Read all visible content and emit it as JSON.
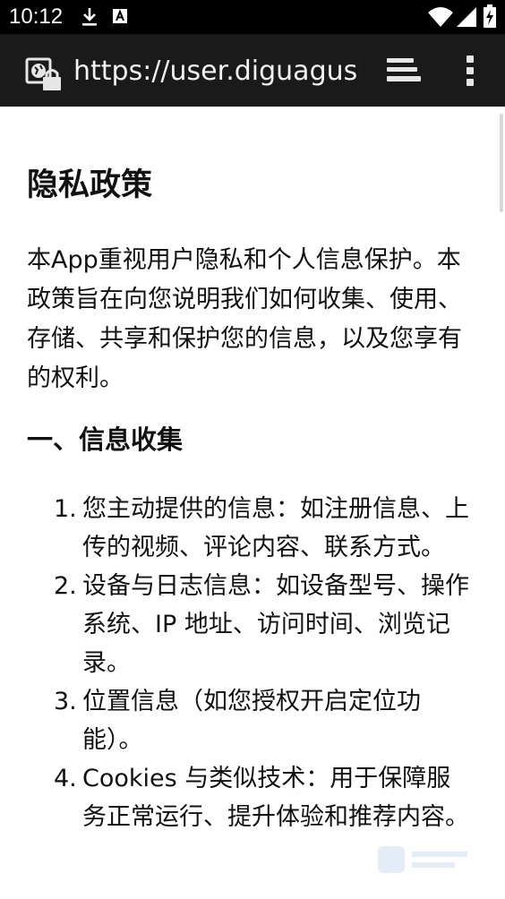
{
  "status_bar": {
    "time": "10:12",
    "icons": [
      "download-icon",
      "keyboard-a-icon",
      "wifi-icon",
      "cell-signal-icon",
      "battery-charging-icon"
    ]
  },
  "browser": {
    "url": "https://user.diguagush",
    "icons": [
      "secure-site-icon",
      "tabs-icon",
      "more-options-icon"
    ]
  },
  "page": {
    "title": "隐私政策",
    "intro": "本App重视用户隐私和个人信息保护。本政策旨在向您说明我们如何收集、使用、存储、共享和保护您的信息，以及您享有的权利。",
    "section_heading": "一、信息收集",
    "items": [
      {
        "num": "1.",
        "text": "您主动提供的信息：如注册信息、上传的视频、评论内容、联系方式。"
      },
      {
        "num": "2.",
        "text": "设备与日志信息：如设备型号、操作系统、IP 地址、访问时间、浏览记录。"
      },
      {
        "num": "3.",
        "text": "位置信息（如您授权开启定位功能）。"
      },
      {
        "num": "4.",
        "text": "Cookies 与类似技术：用于保障服务正常运行、提升体验和推荐内容。"
      }
    ]
  }
}
